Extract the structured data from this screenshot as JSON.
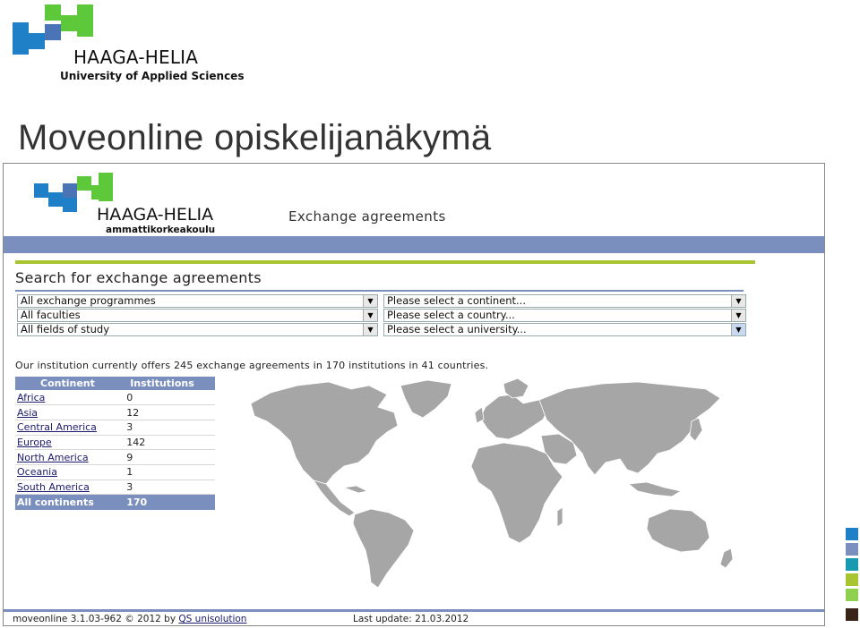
{
  "slide": {
    "logo_brand": "HAAGA-HELIA",
    "logo_subtitle": "University of Applied Sciences",
    "title": "Moveonline opiskelijanäkymä"
  },
  "app": {
    "logo_brand": "HAAGA-HELIA",
    "logo_subtitle": "ammattikorkeakoulu",
    "heading": "Exchange agreements",
    "search_title": "Search for exchange agreements",
    "filters": {
      "programme": "All exchange programmes",
      "faculty": "All faculties",
      "field": "All fields of study",
      "continent": "Please select a continent...",
      "country": "Please select a country...",
      "university": "Please select a university..."
    },
    "info_text": "Our institution currently offers 245 exchange agreements in 170 institutions in 41 countries.",
    "table": {
      "headers": [
        "Continent",
        "Institutions"
      ],
      "rows": [
        {
          "continent": "Africa",
          "institutions": "0"
        },
        {
          "continent": "Asia",
          "institutions": "12"
        },
        {
          "continent": "Central America",
          "institutions": "3"
        },
        {
          "continent": "Europe",
          "institutions": "142"
        },
        {
          "continent": "North America",
          "institutions": "9"
        },
        {
          "continent": "Oceania",
          "institutions": "1"
        },
        {
          "continent": "South America",
          "institutions": "3"
        }
      ],
      "total": {
        "continent": "All continents",
        "institutions": "170"
      }
    },
    "footer": {
      "version": "moveonline 3.1.03-962 © 2012 by",
      "vendor_link": "QS unisolution",
      "last_update": "Last update: 21.03.2012"
    }
  },
  "colors": {
    "brand_blue": "#1f7fc7",
    "brand_green": "#5dc83a",
    "nav_blue": "#7a8fbd",
    "accent_green": "#a8c430",
    "map_gray": "#a6a6a6"
  },
  "icons": [
    "dropdown-arrow-icon",
    "world-map-icon",
    "logo-squares-icon"
  ]
}
